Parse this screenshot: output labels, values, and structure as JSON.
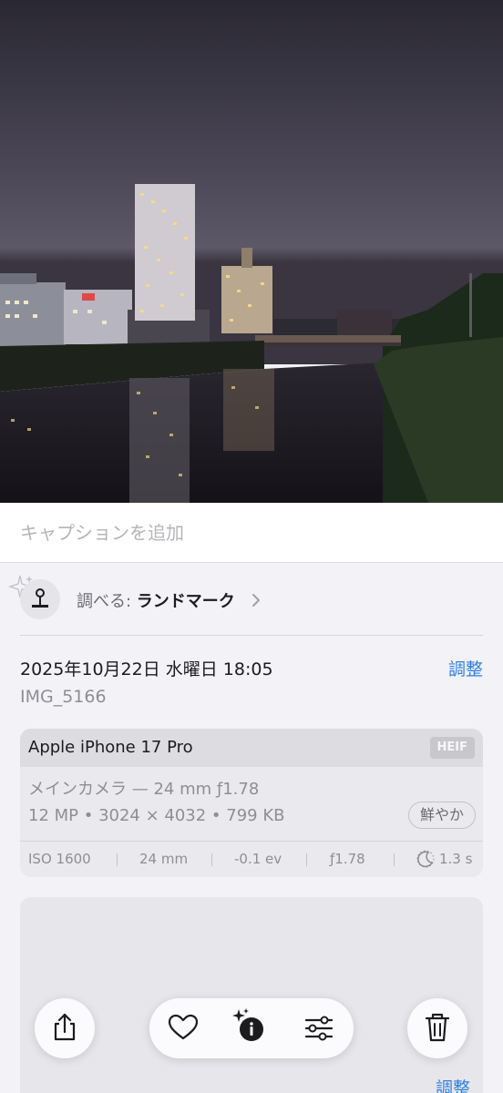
{
  "caption": {
    "placeholder": "キャプションを追加"
  },
  "lookup": {
    "prefix": "調べる: ",
    "value": "ランドマーク"
  },
  "info": {
    "datetime": "2025年10月22日 水曜日 18:05",
    "adjust_label": "調整",
    "filename": "IMG_5166"
  },
  "exif_card": {
    "device": "Apple iPhone 17 Pro",
    "format": "HEIF",
    "lens": "メインカメラ — 24 mm ƒ1.78",
    "specs": "12 MP • 3024 × 4032 • 799 KB",
    "style": "鮮やか",
    "iso": "ISO 1600",
    "focal_length": "24 mm",
    "exposure_bias": "-0.1 ev",
    "aperture": "ƒ1.78",
    "shutter": "1.3 s"
  },
  "location_card": {
    "adjust_label": "調整"
  },
  "toolbar": {
    "share_icon": "share-icon",
    "favorite_icon": "heart-icon",
    "info_icon": "sparkle-info-icon",
    "edit_icon": "sliders-icon",
    "delete_icon": "trash-icon"
  },
  "colors": {
    "accent": "#2f80e0",
    "background": "#f2f2f7",
    "card": "#eaeaee"
  }
}
